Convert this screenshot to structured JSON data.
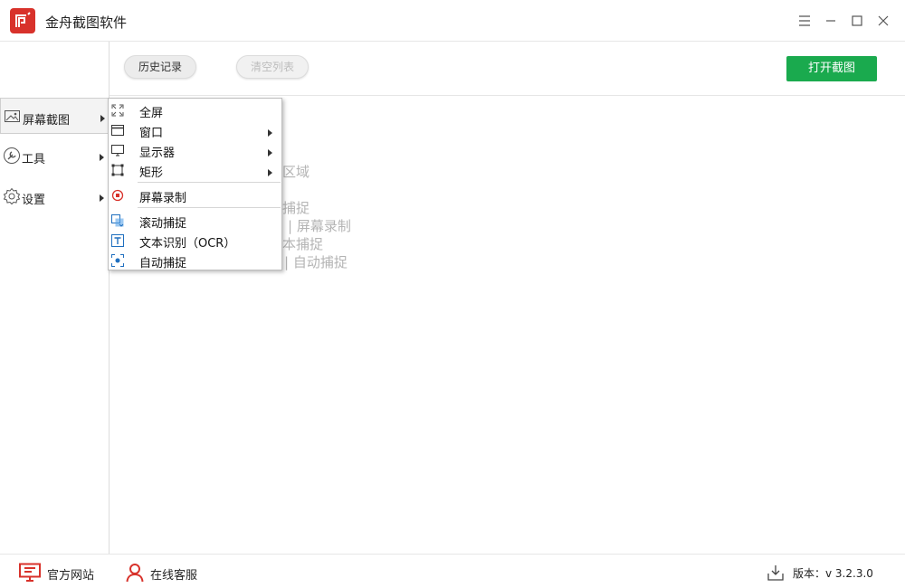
{
  "app": {
    "title": "金舟截图软件"
  },
  "window_controls": [
    "menu-icon",
    "minimize-icon",
    "maximize-icon",
    "close-icon"
  ],
  "sidebar": {
    "items": [
      {
        "label": "屏幕截图",
        "icon": "image-icon",
        "active": true
      },
      {
        "label": "工具",
        "icon": "wrench-icon",
        "active": false
      },
      {
        "label": "设置",
        "icon": "gear-icon",
        "active": false
      }
    ]
  },
  "toolbar": {
    "history_label": "历史记录",
    "clear_label": "清空列表",
    "open_capture_label": "打开截图"
  },
  "background_hints": [
    "区域",
    "捕捉",
    "| 屏幕录制",
    "本捕捉",
    "| 自动捕捉"
  ],
  "menu": {
    "items": [
      {
        "label": "全屏",
        "icon": "fullscreen-icon",
        "submenu": false
      },
      {
        "label": "窗口",
        "icon": "window-icon",
        "submenu": true
      },
      {
        "label": "显示器",
        "icon": "monitor-icon",
        "submenu": true
      },
      {
        "label": "矩形",
        "icon": "rectangle-select-icon",
        "submenu": true
      },
      {
        "label": "屏幕录制",
        "icon": "record-icon",
        "submenu": false
      },
      {
        "label": "滚动捕捉",
        "icon": "scroll-capture-icon",
        "submenu": false
      },
      {
        "label": "文本识别（OCR）",
        "icon": "ocr-icon",
        "submenu": false
      },
      {
        "label": "自动捕捉",
        "icon": "auto-capture-icon",
        "submenu": false
      }
    ]
  },
  "footer": {
    "website_label": "官方网站",
    "support_label": "在线客服",
    "version_label": "版本：v 3.2.3.0"
  },
  "colors": {
    "brand_red": "#d8322b",
    "primary_green": "#1aaa4e",
    "hint_gray": "#b4b4b4"
  }
}
